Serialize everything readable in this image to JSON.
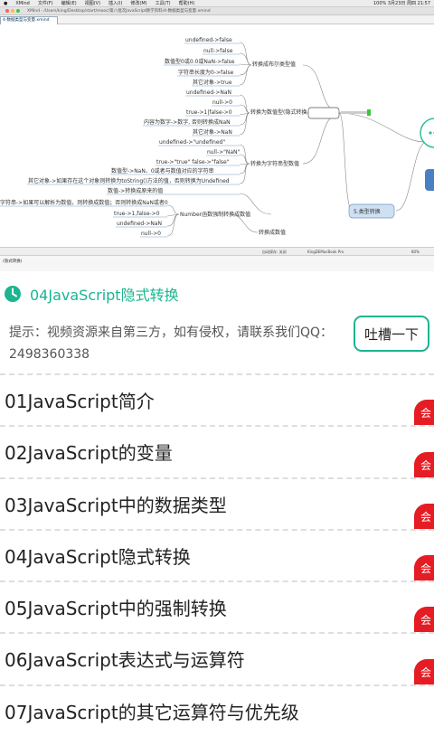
{
  "video": {
    "menubar": {
      "app": "XMind",
      "menus": [
        "文件(F)",
        "编辑(E)",
        "视图(V)",
        "插入(I)",
        "修改(M)",
        "工具(T)",
        "帮助(H)"
      ],
      "status_right": "100% 3月23日 周四 21:57"
    },
    "window_title": "XMind - /Users/king/Desktop/start/mooc/第八批次JavaScript教学资料/4-数据类型与变量.xmind",
    "tab_label": "4-数据类型与变量.xmind",
    "mindmap_nodes": [
      "undefined->false",
      "null->false",
      "数值型0或0.0或NaN->false",
      "字符串长度为0->false",
      "其它对象->true",
      "undefined->NaN",
      "null->0",
      "true->1|false->0",
      "内容为数字->数字, 否则转换成NaN",
      "其它对象->NaN",
      "undefined->\"undefined\"",
      "null->\"NaN\"",
      "true->\"true\" false->\"false\"",
      "数值型->NaN、0或者与数值对应的字符串",
      "其它对象->如果存在这个对象则转换为toString()方法的值，否则转换为Undefined",
      "数值->转换成原来的值",
      "字符串->如果可以解析为数值，则转换成数值；否则转换成NaN或者0",
      "true->1,false->0",
      "undefined->NaN",
      "null->0"
    ],
    "branches": {
      "to_boolean": "转换成布尔类型值",
      "to_number": "转换为数值型(隐式转换",
      "to_string": "转换为字符串型数值",
      "number_func": "Number函数强制转换成数值",
      "to_numeric": "转换成数值",
      "type_conv": "5.类型转换"
    },
    "status_left": "自动保存: 关闭",
    "status_mid": "KingDEMacBook Pro",
    "status_right": "80%",
    "panel_label": "(隐式转换)"
  },
  "lesson": {
    "current_title": "04JavaScript隐式转换",
    "notice": "提示：视频资源来自第三方，如有侵权，请联系我们QQ：2498360338",
    "feedback_label": "吐槽一下",
    "badge_label": "会",
    "items": [
      "01JavaScript简介",
      "02JavaScript的变量",
      "03JavaScript中的数据类型",
      "04JavaScript隐式转换",
      "05JavaScript中的强制转换",
      "06JavaScript表达式与运算符",
      "07JavaScript的其它运算符与优先级"
    ]
  },
  "colors": {
    "accent": "#1bb58f",
    "badge": "#e51c23"
  }
}
